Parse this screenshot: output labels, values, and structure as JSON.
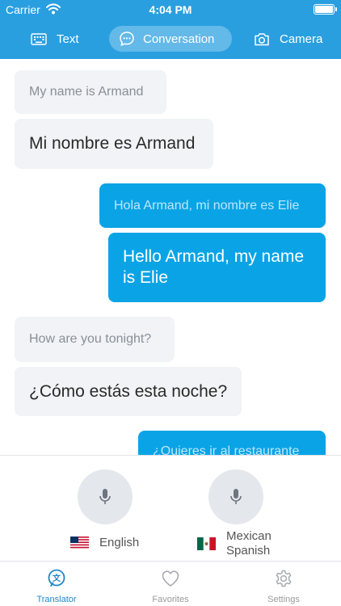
{
  "status_bar": {
    "carrier": "Carrier",
    "time": "4:04 PM"
  },
  "mode_tabs": [
    {
      "label": "Text",
      "icon": "keyboard-icon",
      "active": false
    },
    {
      "label": "Conversation",
      "icon": "chat-bubble-icon",
      "active": true
    },
    {
      "label": "Camera",
      "icon": "camera-icon",
      "active": false
    }
  ],
  "messages": [
    {
      "sender": "them",
      "original": "My name is Armand",
      "translation": "Mi nombre es Armand"
    },
    {
      "sender": "me",
      "original": "Hola Armand, mi nombre es Elie",
      "translation": "Hello Armand, my name is Elie"
    },
    {
      "sender": "them",
      "original": "How are you tonight?",
      "translation": "¿Cómo estás esta noche?"
    },
    {
      "sender": "me",
      "original": "¿Quieres ir al restaurante",
      "translation": ""
    }
  ],
  "languages": {
    "left": {
      "name": "English",
      "flag": "us-flag-icon"
    },
    "right": {
      "name_line1": "Mexican",
      "name_line2": "Spanish",
      "flag": "mexico-flag-icon"
    }
  },
  "tabbar": [
    {
      "label": "Translator",
      "icon": "translator-icon",
      "active": true
    },
    {
      "label": "Favorites",
      "icon": "heart-icon",
      "active": false
    },
    {
      "label": "Settings",
      "icon": "gear-icon",
      "active": false
    }
  ],
  "colors": {
    "brand": "#2a9fe0",
    "outgoing_bubble": "#0aa4e6",
    "incoming_bubble": "#f1f3f6",
    "active_tab": "#1e88c8"
  }
}
